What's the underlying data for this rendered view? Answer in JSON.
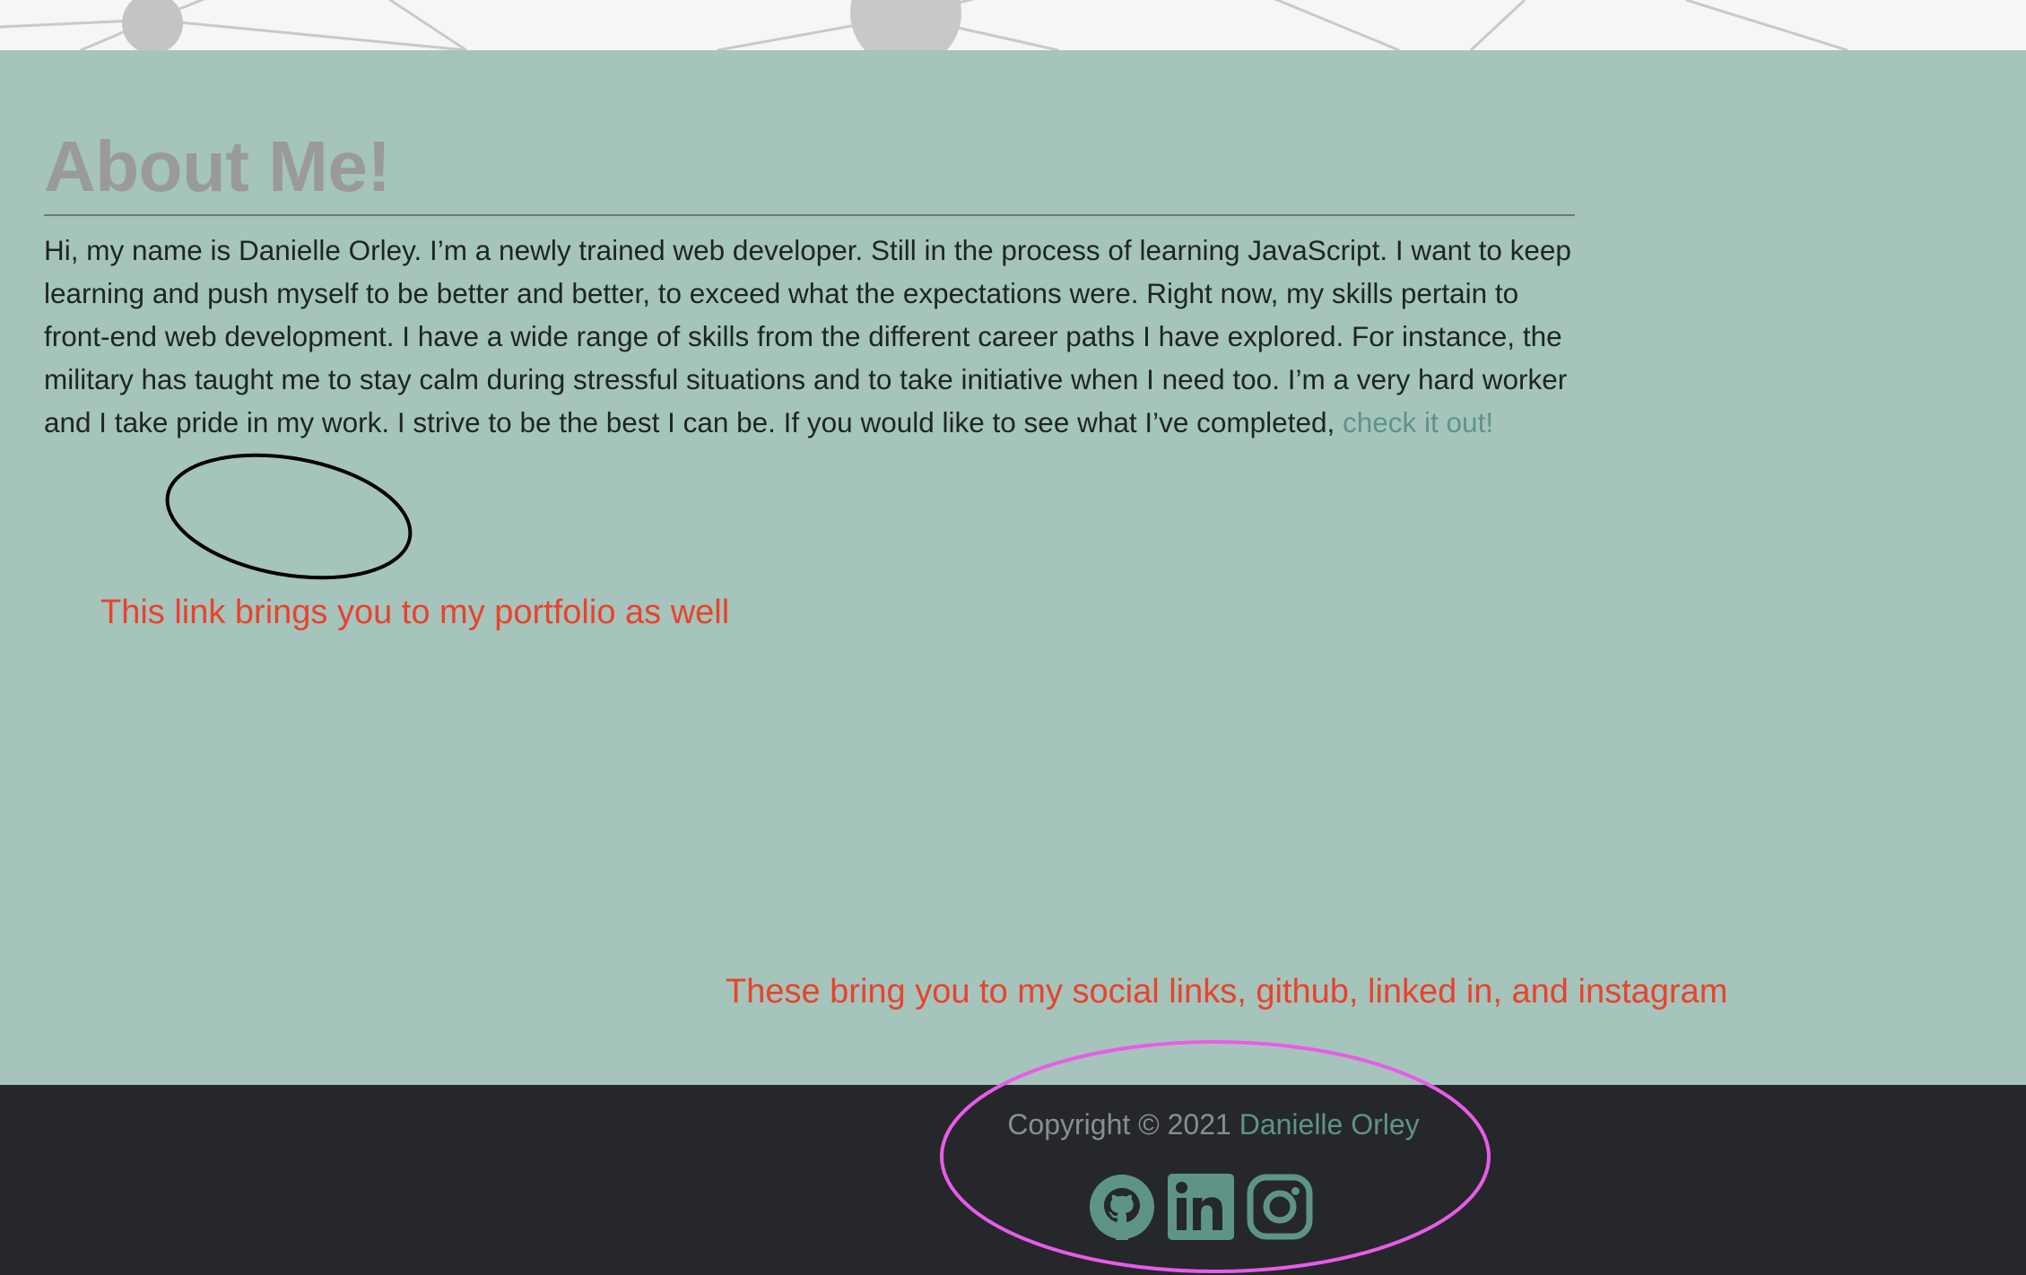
{
  "about": {
    "heading": "About Me!",
    "body_text": "Hi, my name is Danielle Orley. I’m a newly trained web developer. Still in the process of learning JavaScript. I want to keep learning and push myself to be better and better, to exceed what the expectations were. Right now, my skills pertain to front-end web development. I have a wide range of skills from the different career paths I have explored. For instance, the military has taught me to stay calm during stressful situations and to take initiative when I need too. I’m a very hard worker and I take pride in my work. I strive to be the best I can be. If you would like to see what I’ve completed, ",
    "link_text": "check it out!"
  },
  "annotations": {
    "link_note": "This link brings you to my portfolio as well",
    "social_note": "These bring you to my social links, github, linked in, and instagram"
  },
  "footer": {
    "copyright_prefix": "Copyright © 2021 ",
    "name": "Danielle Orley",
    "social_icons": [
      "github-icon",
      "linkedin-icon",
      "instagram-icon"
    ]
  },
  "colors": {
    "section_bg": "#a5c4bb",
    "heading": "#9a9a9a",
    "accent_link": "#5e9486",
    "footer_bg": "#25272b",
    "annotation_text": "#e8432c",
    "annotation_circle_link": "#000000",
    "annotation_circle_social": "#e85ce8"
  }
}
